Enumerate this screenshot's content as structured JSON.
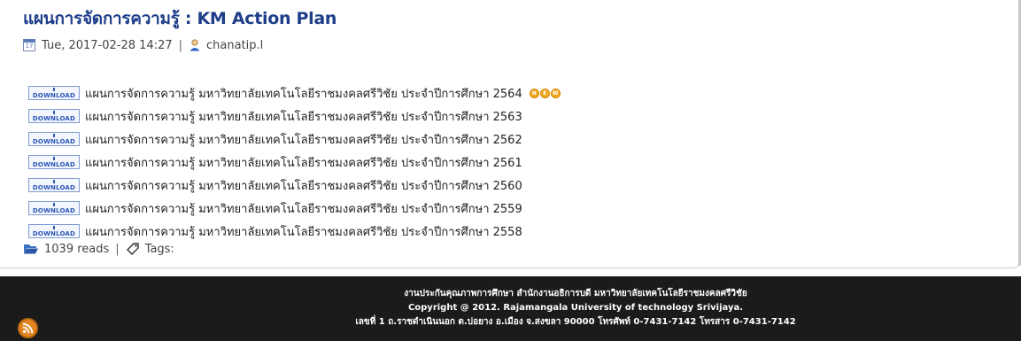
{
  "page": {
    "title": "แผนการจัดการความรู้ : KM Action Plan",
    "meta": {
      "date": "Tue, 2017-02-28 14:27",
      "separator": "|",
      "author": "chanatip.l"
    },
    "download_icon_label": "DOWNLOAD",
    "items": [
      {
        "text": "แผนการจัดการความรู้ มหาวิทยาลัยเทคโนโลยีราชมงคลศรีวิชัย ประจำปีการศึกษา 2564",
        "badge": "NEW"
      },
      {
        "text": "แผนการจัดการความรู้ มหาวิทยาลัยเทคโนโลยีราชมงคลศรีวิชัย ประจำปีการศึกษา 2563"
      },
      {
        "text": "แผนการจัดการความรู้ มหาวิทยาลัยเทคโนโลยีราชมงคลศรีวิชัย ประจำปีการศึกษา 2562"
      },
      {
        "text": "แผนการจัดการความรู้ มหาวิทยาลัยเทคโนโลยีราชมงคลศรีวิชัย ประจำปีการศึกษา 2561"
      },
      {
        "text": "แผนการจัดการความรู้ มหาวิทยาลัยเทคโนโลยีราชมงคลศรีวิชัย ประจำปีการศึกษา 2560"
      },
      {
        "text": "แผนการจัดการความรู้ มหาวิทยาลัยเทคโนโลยีราชมงคลศรีวิชัย ประจำปีการศึกษา 2559"
      },
      {
        "text": "แผนการจัดการความรู้ มหาวิทยาลัยเทคโนโลยีราชมงคลศรีวิชัย ประจำปีการศึกษา 2558"
      }
    ],
    "stats": {
      "reads": "1039 reads",
      "separator": "|",
      "tags_label": "Tags:"
    }
  },
  "footer": {
    "line1": "งานประกันคุณภาพการศึกษา สำนักงานอธิการบดี  มหาวิทยาลัยเทคโนโลยีราชมงคลศรีวิชัย",
    "line2": "Copyright @ 2012. Rajamangala University of technology Srivijaya.",
    "line3": "เลขที่ 1 ถ.ราชดำเนินนอก ต.บ่อยาง อ.เมือง จ.สงขลา 90000 โทรศัพท์  0-7431-7142 โทรสาร  0-7431-7142"
  },
  "icons": {
    "calendar": "calendar-icon",
    "user": "user-icon",
    "download": "download-icon",
    "folder": "folder-open-icon",
    "tag": "tag-icon",
    "rss": "rss-icon"
  },
  "colors": {
    "title": "#1e3e8a",
    "footer_bg": "#1b1b1b",
    "badge": "#f0a81d",
    "download": "#2a57b8"
  }
}
